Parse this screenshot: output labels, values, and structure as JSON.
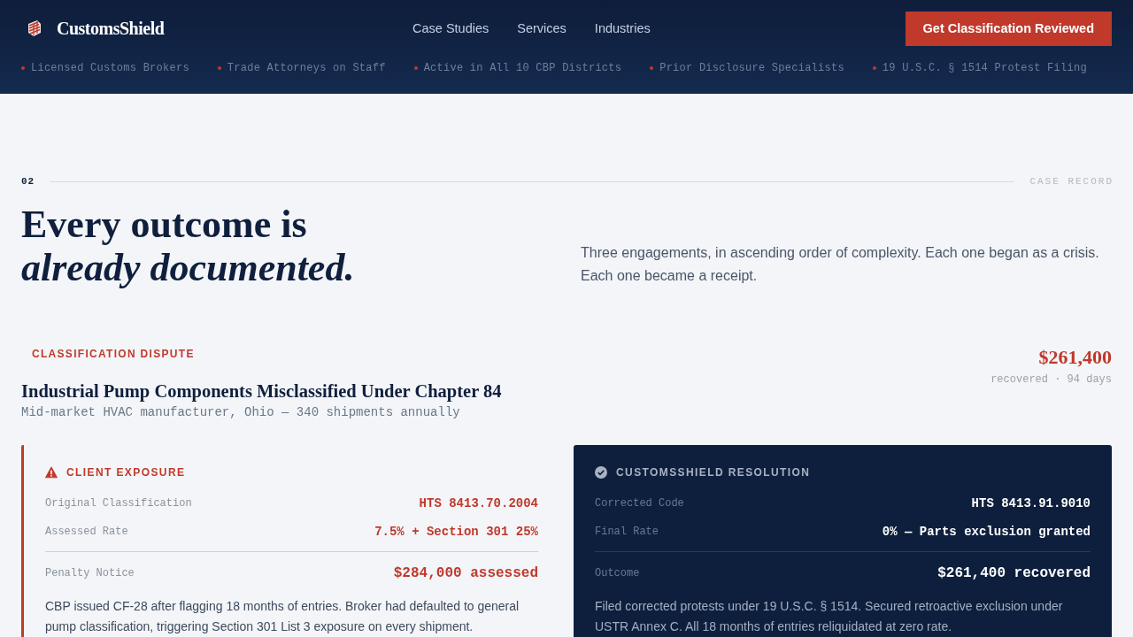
{
  "header": {
    "brand": "CustomsShield",
    "nav": [
      "Case Studies",
      "Services",
      "Industries"
    ],
    "cta": "Get Classification Reviewed",
    "trust_items": [
      "Licensed Customs Brokers",
      "Trade Attorneys on Staff",
      "Active in All 10 CBP Districts",
      "Prior Disclosure Specialists",
      "19 U.S.C. § 1514 Protest Filing"
    ]
  },
  "section": {
    "number": "02",
    "label": "CASE RECORD",
    "heading_line_1": "Every outcome is",
    "heading_line_2": "already documented.",
    "intro": "Three engagements, in ascending order of complexity. Each one began as a crisis. Each one became a receipt."
  },
  "case": {
    "tag": "CLASSIFICATION DISPUTE",
    "title": "Industrial Pump Components Misclassified Under Chapter 84",
    "subtitle": "Mid-market HVAC manufacturer, Ohio — 340 shipments annually",
    "amount": "$261,400",
    "amount_note": "recovered · 94 days",
    "panels": [
      {
        "kind": "exposure",
        "title": "CLIENT EXPOSURE",
        "rows": [
          {
            "label": "Original Classification",
            "value": "HTS 8413.70.2004"
          },
          {
            "label": "Assessed Rate",
            "value": "7.5% + Section 301 25%"
          }
        ],
        "total": {
          "label": "Penalty Notice",
          "value": "$284,000 assessed"
        },
        "note": "CBP issued CF-28 after flagging 18 months of entries. Broker had defaulted to general pump classification, triggering Section 301 List 3 exposure on every shipment."
      },
      {
        "kind": "resolution",
        "title": "CUSTOMSSHIELD RESOLUTION",
        "rows": [
          {
            "label": "Corrected Code",
            "value": "HTS 8413.91.9010"
          },
          {
            "label": "Final Rate",
            "value": "0% — Parts exclusion granted"
          }
        ],
        "total": {
          "label": "Outcome",
          "value": "$261,400 recovered"
        },
        "note": "Filed corrected protests under 19 U.S.C. § 1514. Secured retroactive exclusion under USTR Annex C. All 18 months of entries reliquidated at zero rate."
      }
    ]
  }
}
